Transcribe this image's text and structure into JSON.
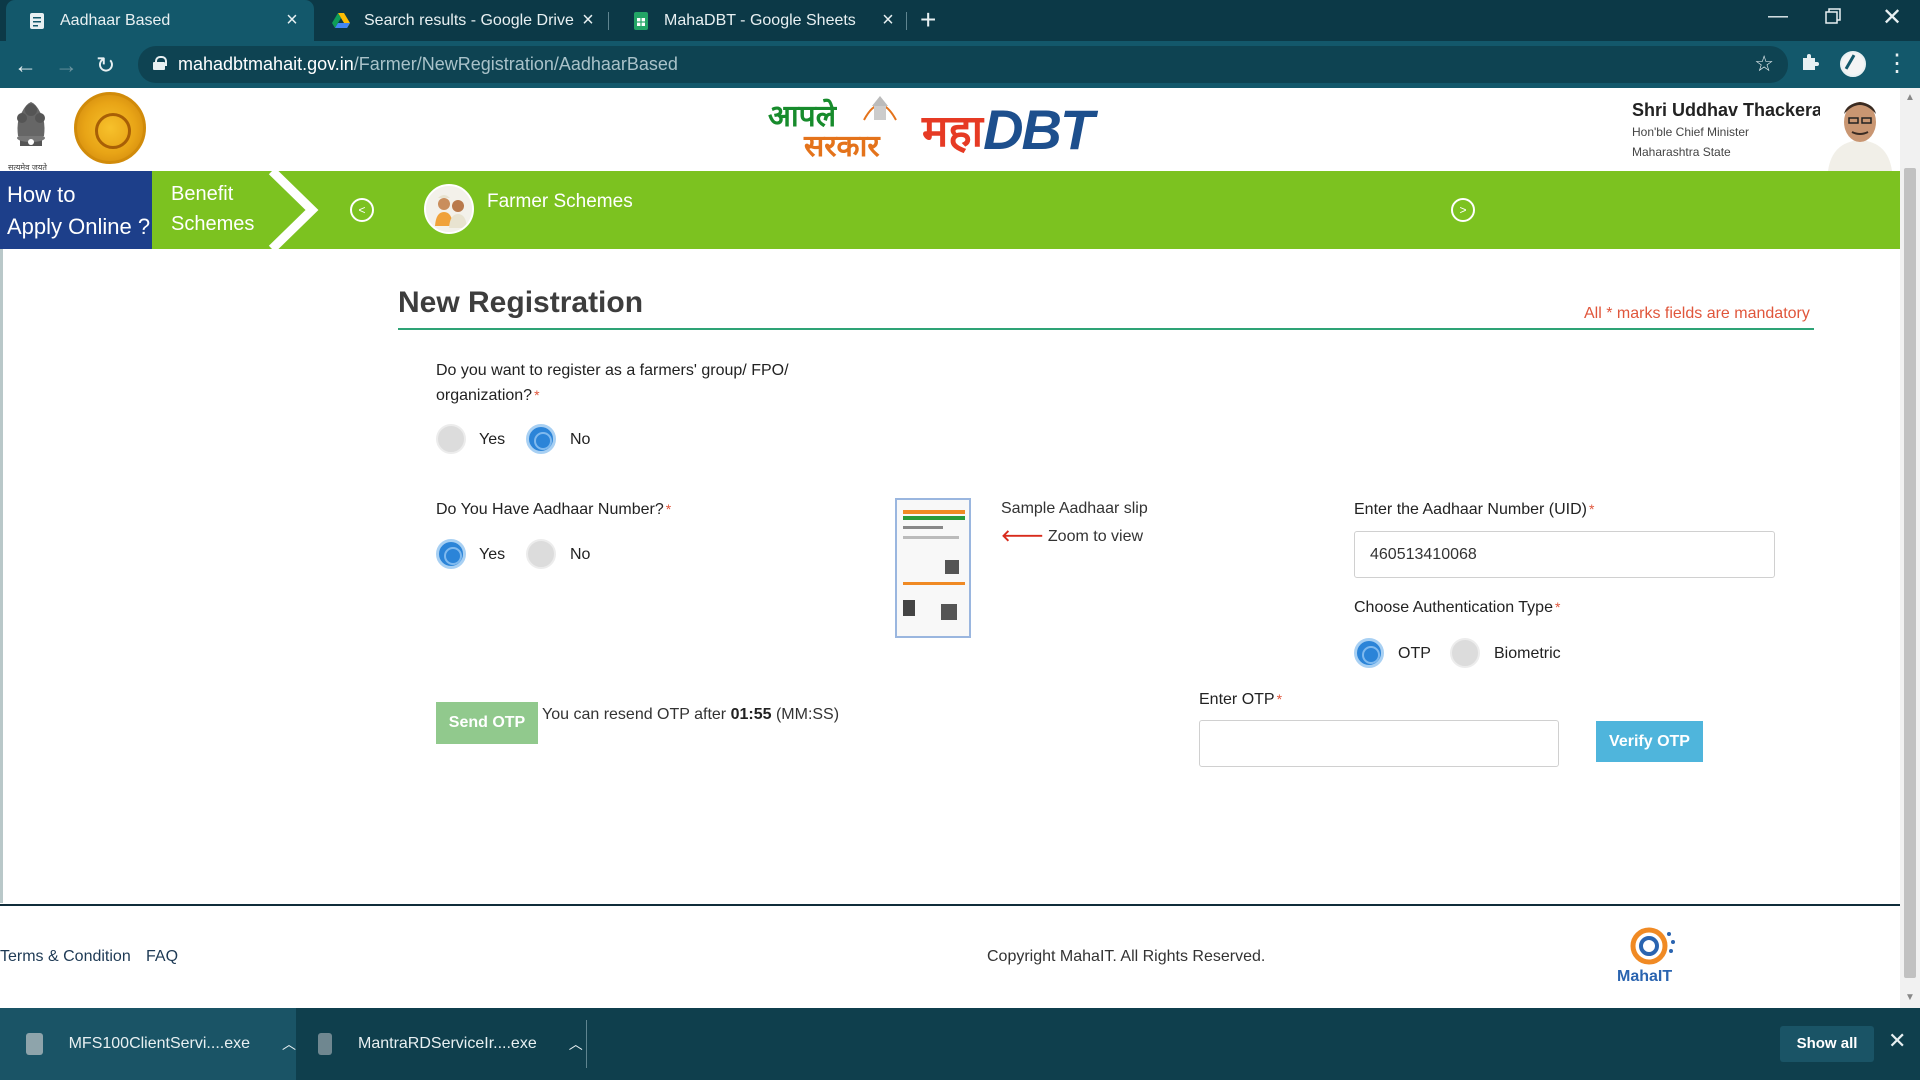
{
  "browser": {
    "tabs": [
      {
        "title": "Aadhaar Based",
        "icon": "document-icon",
        "active": true
      },
      {
        "title": "Search results - Google Drive",
        "icon": "google-drive-icon",
        "active": false
      },
      {
        "title": "MahaDBT - Google Sheets",
        "icon": "google-sheets-icon",
        "active": false
      }
    ],
    "url_host": "mahadbtmahait.gov.in",
    "url_path": "/Farmer/NewRegistration/AadhaarBased"
  },
  "header": {
    "logo_aaple_line1": "आपले",
    "logo_aaple_line2": "सरकार",
    "logo_maha": "महा",
    "logo_dbt": "DBT",
    "emblem_caption": "सत्यमेव जयते",
    "cm_name": "Shri Uddhav Thackeray",
    "cm_title": "Hon'ble Chief Minister",
    "cm_state": "Maharashtra State"
  },
  "nav": {
    "how_to_line1": "How to",
    "how_to_line2": "Apply Online ?",
    "benefit_line1": "Benefit",
    "benefit_line2": "Schemes",
    "farmer_schemes": "Farmer Schemes"
  },
  "form": {
    "title": "New Registration",
    "mandatory_note": "All * marks fields are mandatory",
    "q_fpo_line1": "Do you want to register as a farmers' group/ FPO/",
    "q_fpo_line2": "organization?",
    "fpo_yes": "Yes",
    "fpo_no": "No",
    "fpo_selected": "No",
    "q_aadhaar": "Do You Have Aadhaar Number?",
    "aadhaar_yes": "Yes",
    "aadhaar_no": "No",
    "aadhaar_selected": "Yes",
    "sample_slip": "Sample Aadhaar slip",
    "zoom_to_view": "Zoom to view",
    "uid_label": "Enter the Aadhaar Number (UID)",
    "uid_value": "460513410068",
    "auth_label": "Choose Authentication Type",
    "auth_otp": "OTP",
    "auth_biometric": "Biometric",
    "auth_selected": "OTP",
    "otp_label": "Enter OTP",
    "otp_value": "",
    "send_otp": "Send OTP",
    "resend_prefix": "You can resend OTP after",
    "resend_time": "01:55",
    "resend_suffix": "(MM:SS)",
    "verify_otp": "Verify OTP",
    "required_mark": "*"
  },
  "footer": {
    "terms": "Terms & Condition",
    "faq": "FAQ",
    "copyright": "Copyright MahaIT. All Rights Reserved.",
    "mahait_logo_text": "MahaIT"
  },
  "downloads": {
    "items": [
      {
        "name": "MFS100ClientServi....exe"
      },
      {
        "name": "MantraRDServiceIr....exe"
      }
    ],
    "show_all": "Show all"
  },
  "colors": {
    "nav_green": "#7cc220",
    "howto_blue": "#1d3f8a",
    "radio_selected": "#2b84d8",
    "mandatory_red": "#e0563b",
    "send_otp_bg": "#91c98d",
    "verify_otp_bg": "#4fb5dc"
  }
}
